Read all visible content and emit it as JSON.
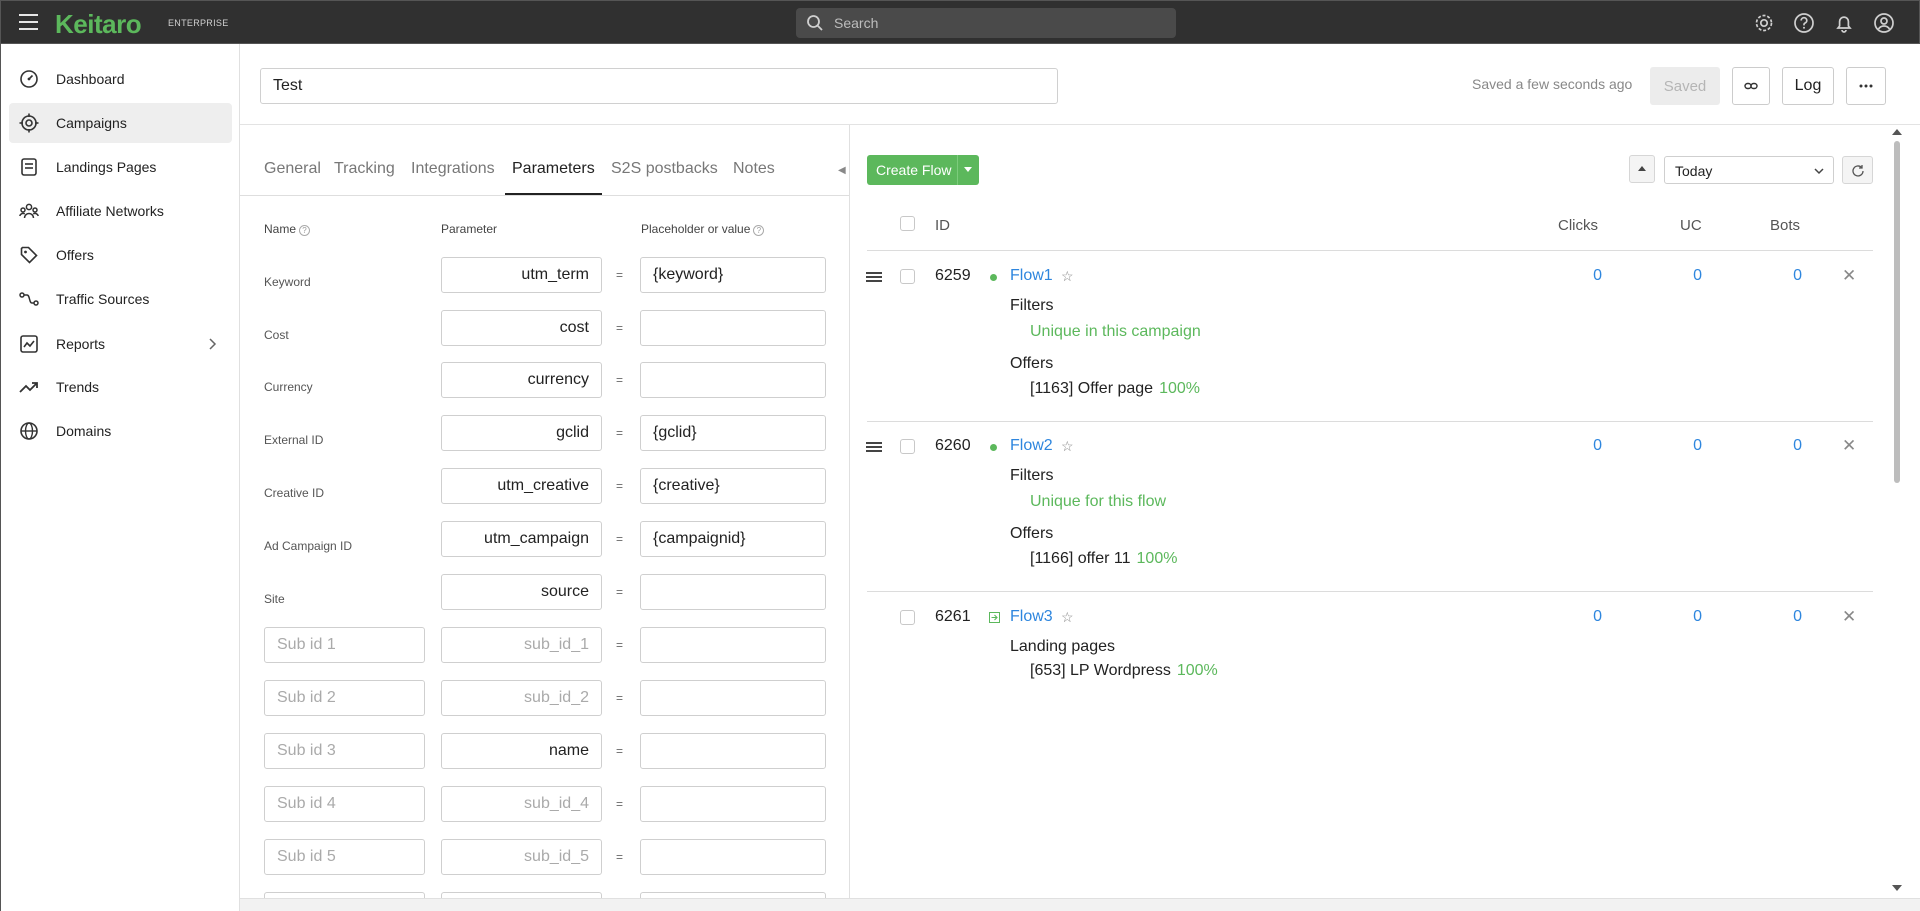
{
  "app": {
    "logo": "Keitaro",
    "edition": "ENTERPRISE",
    "search_placeholder": "Search"
  },
  "sidebar": {
    "items": [
      {
        "label": "Dashboard",
        "icon": "dashboard-icon"
      },
      {
        "label": "Campaigns",
        "icon": "campaigns-icon",
        "active": true
      },
      {
        "label": "Landings Pages",
        "icon": "landing-pages-icon"
      },
      {
        "label": "Affiliate Networks",
        "icon": "affiliate-networks-icon"
      },
      {
        "label": "Offers",
        "icon": "offers-icon"
      },
      {
        "label": "Traffic Sources",
        "icon": "traffic-sources-icon"
      },
      {
        "label": "Reports",
        "icon": "reports-icon"
      },
      {
        "label": "Trends",
        "icon": "trends-icon"
      },
      {
        "label": "Domains",
        "icon": "domains-icon"
      }
    ]
  },
  "campaign": {
    "name": "Test",
    "saved_status": "Saved a few seconds ago",
    "saved_button": "Saved",
    "log_button": "Log"
  },
  "tabs": [
    "General",
    "Tracking",
    "Integrations",
    "Parameters",
    "S2S postbacks",
    "Notes"
  ],
  "active_tab": "Parameters",
  "parameters": {
    "headers": {
      "name": "Name",
      "parameter": "Parameter",
      "value": "Placeholder or value"
    },
    "rows": [
      {
        "name": "Keyword",
        "parameter": "utm_term",
        "value": "{keyword}"
      },
      {
        "name": "Cost",
        "parameter": "cost",
        "value": ""
      },
      {
        "name": "Currency",
        "parameter": "currency",
        "value": ""
      },
      {
        "name": "External ID",
        "parameter": "gclid",
        "value": "{gclid}"
      },
      {
        "name": "Creative ID",
        "parameter": "utm_creative",
        "value": "{creative}"
      },
      {
        "name": "Ad Campaign ID",
        "parameter": "utm_campaign",
        "value": "{campaignid}"
      },
      {
        "name": "Site",
        "parameter": "source",
        "value": ""
      }
    ],
    "sub_rows": [
      {
        "name_placeholder": "Sub id 1",
        "parameter": "",
        "parameter_placeholder": "sub_id_1",
        "value": ""
      },
      {
        "name_placeholder": "Sub id 2",
        "parameter": "",
        "parameter_placeholder": "sub_id_2",
        "value": ""
      },
      {
        "name_placeholder": "Sub id 3",
        "parameter": "name",
        "parameter_placeholder": "",
        "value": ""
      },
      {
        "name_placeholder": "Sub id 4",
        "parameter": "",
        "parameter_placeholder": "sub_id_4",
        "value": ""
      },
      {
        "name_placeholder": "Sub id 5",
        "parameter": "",
        "parameter_placeholder": "sub_id_5",
        "value": ""
      }
    ],
    "equals": "="
  },
  "flows_toolbar": {
    "create_flow": "Create Flow",
    "date_range": "Today"
  },
  "flows_table": {
    "columns": {
      "id": "ID",
      "clicks": "Clicks",
      "uc": "UC",
      "bots": "Bots"
    },
    "flows": [
      {
        "id": "6259",
        "name": "Flow1",
        "clicks": "0",
        "uc": "0",
        "bots": "0",
        "filters_label": "Filters",
        "filter": "Unique in this campaign",
        "offers_label": "Offers",
        "offer": "[1163] Offer page",
        "offer_pct": "100%"
      },
      {
        "id": "6260",
        "name": "Flow2",
        "clicks": "0",
        "uc": "0",
        "bots": "0",
        "filters_label": "Filters",
        "filter": "Unique for this flow",
        "offers_label": "Offers",
        "offer": "[1166] offer 11",
        "offer_pct": "100%"
      },
      {
        "id": "6261",
        "name": "Flow3",
        "clicks": "0",
        "uc": "0",
        "bots": "0",
        "landings_label": "Landing pages",
        "landing": "[653] LP Wordpress",
        "landing_pct": "100%"
      }
    ]
  },
  "colors": {
    "brand_green": "#5cb85c",
    "link_blue": "#2e86de",
    "topbar": "#303030"
  }
}
